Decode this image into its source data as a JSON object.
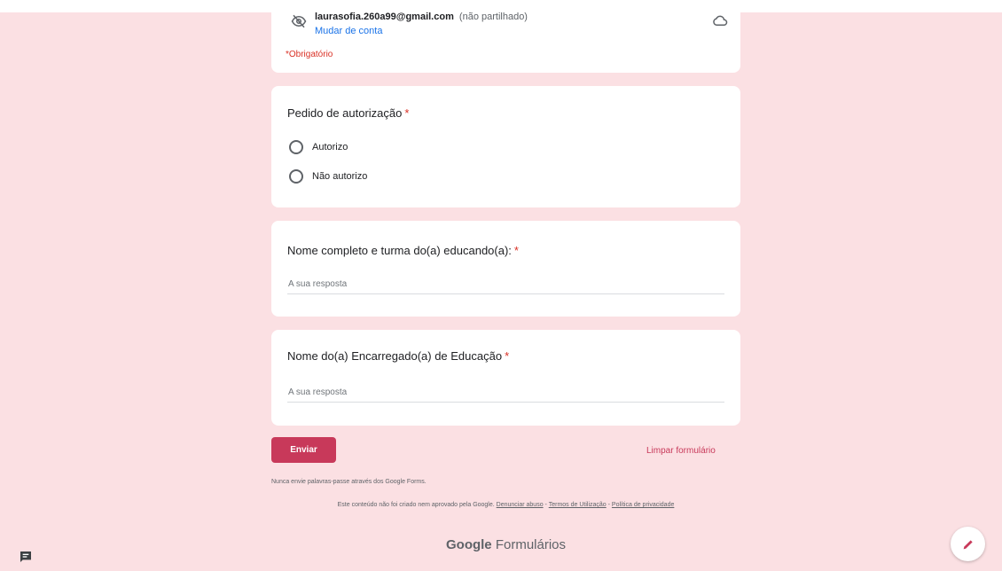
{
  "account": {
    "email": "laurasofia.260a99@gmail.com",
    "share_note": "(não partilhado)",
    "switch_label": "Mudar de conta",
    "required_note": "*Obrigatório",
    "icons": [
      "eye-off-icon",
      "cloud-icon"
    ]
  },
  "questions": [
    {
      "title": "Pedido de autorização",
      "required_mark": "*",
      "type": "radio",
      "options": [
        "Autorizo",
        "Não autorizo"
      ]
    },
    {
      "title": "Nome completo e turma do(a) educando(a):",
      "required_mark": "*",
      "type": "text",
      "placeholder": "A sua resposta"
    },
    {
      "title": "Nome do(a) Encarregado(a) de Educação",
      "required_mark": "*",
      "type": "text",
      "placeholder": "A sua resposta"
    }
  ],
  "actions": {
    "submit_label": "Enviar",
    "clear_label": "Limpar formulário"
  },
  "footer": {
    "never_note": "Nunca envie palavras-passe através dos Google Forms.",
    "disclaimer_text": "Este conteúdo não foi criado nem aprovado pela Google.",
    "links": [
      "Denunciar abuso",
      "Termos de Utilização",
      "Política de privacidade"
    ],
    "separator": " - ",
    "brand_google": "Google",
    "brand_product": "Formulários"
  },
  "colors": {
    "background": "#fbe0e3",
    "accent": "#c8395a",
    "required": "#d93025",
    "link": "#1a73e8"
  }
}
